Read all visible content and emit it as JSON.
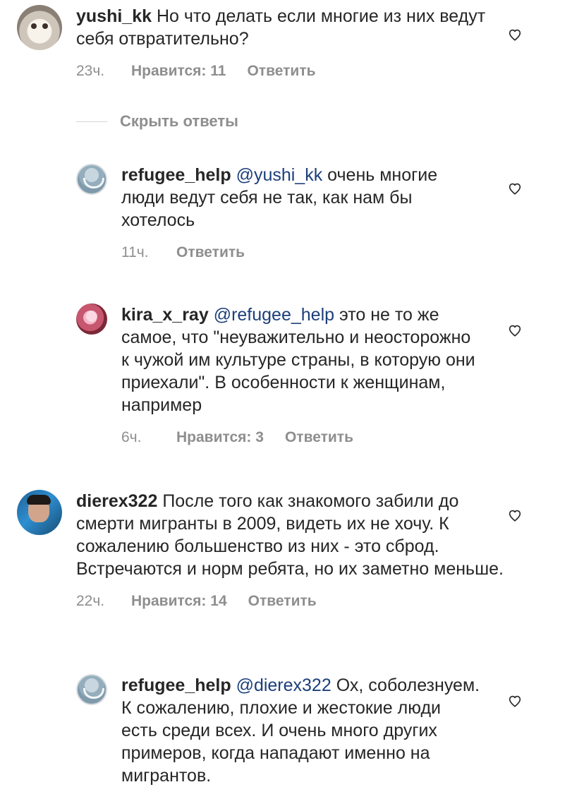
{
  "comments": [
    {
      "username": "yushi_kk",
      "text": "Но что делать если многие из них ведут себя отвратительно?",
      "time": "23ч.",
      "likes": "Нравится: 11",
      "reply": "Ответить"
    },
    {
      "username": "refugee_help",
      "mention": "@yushi_kk",
      "text": "очень многие люди ведут себя не так, как нам бы хотелось",
      "time": "11ч.",
      "reply": "Ответить"
    },
    {
      "username": "kira_x_ray",
      "mention": "@refugee_help",
      "text": "это не то же самое, что \"неуважительно и неосторожно к чужой им культуре страны, в которую они приехали\". В особенности к женщинам, например",
      "time": "6ч.",
      "likes": "Нравится: 3",
      "reply": "Ответить"
    },
    {
      "username": "dierex322",
      "text": "После того как знакомого забили до смерти мигранты в 2009, видеть их не хочу. К сожалению большенство из них - это сброд. Встречаются и норм ребята, но их заметно меньше.",
      "time": "22ч.",
      "likes": "Нравится: 14",
      "reply": "Ответить"
    },
    {
      "username": "refugee_help",
      "mention": "@dierex322",
      "text": "Ох, соболезнуем. К сожалению, плохие и жестокие люди есть среди всех. И очень много других примеров, когда нападают именно на мигрантов."
    }
  ],
  "replies_toggle": "Скрыть ответы",
  "icons": {
    "heart": "heart-icon"
  },
  "colors": {
    "text": "#262626",
    "secondary": "#8e8e8e",
    "mention": "#1c3f7a",
    "divider": "#d5d5d5"
  }
}
